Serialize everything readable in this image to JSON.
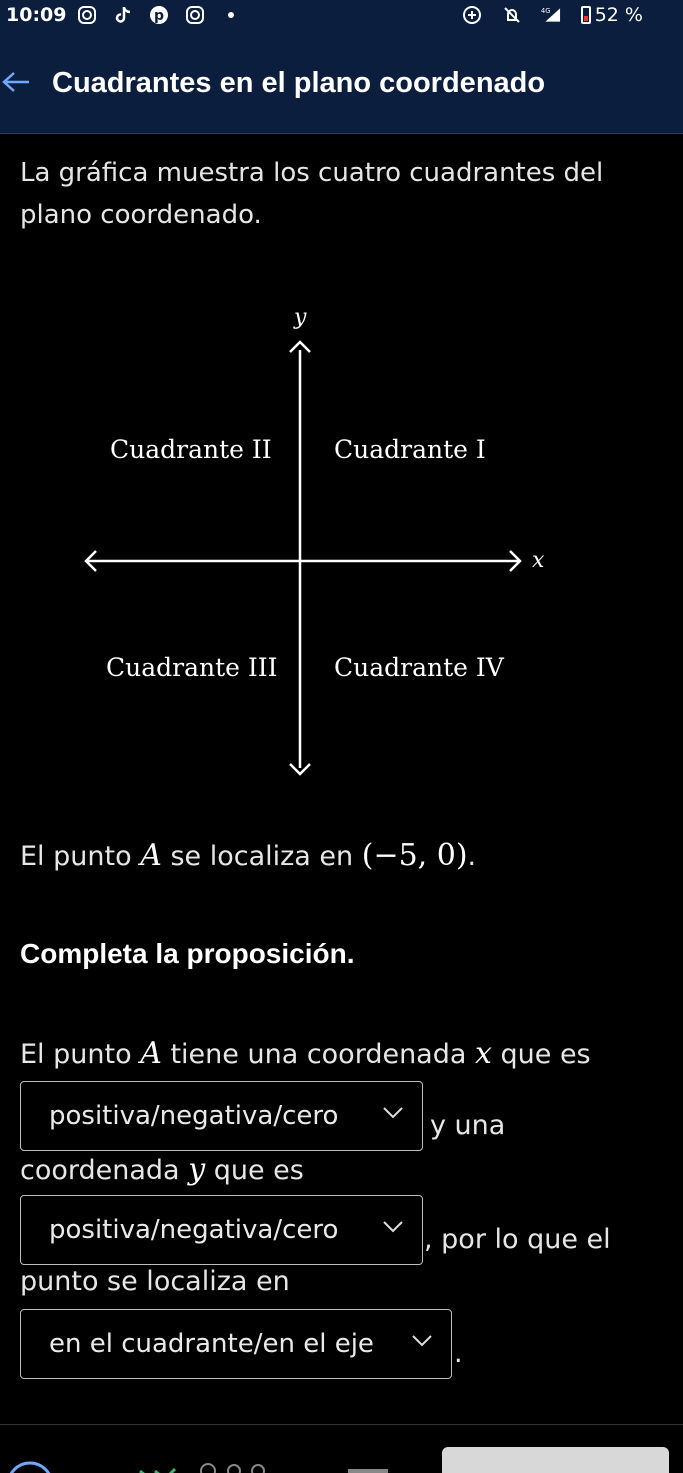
{
  "status_bar": {
    "time": "10:09",
    "battery": "52 %",
    "network": "4G"
  },
  "header": {
    "title": "Cuadrantes en el plano coordenado"
  },
  "intro_text": "La gráfica muestra los cuatro cuadrantes del plano coordenado.",
  "graph": {
    "y_axis_label": "y",
    "x_axis_label": "x",
    "quadrants": [
      "Cuadrante I",
      "Cuadrante II",
      "Cuadrante III",
      "Cuadrante IV"
    ]
  },
  "point_statement": {
    "prefix": "El punto ",
    "point_name": "A",
    "middle": " se localiza en ",
    "coordinates": "(−5, 0)",
    "suffix": "."
  },
  "instruction": "Completa la proposición.",
  "proposition": {
    "part1_prefix": "El punto ",
    "part1_point": "A",
    "part1_middle": " tiene una coordenada ",
    "part1_var": "x",
    "part1_suffix": " que es",
    "dropdown1": "positiva/negativa/cero",
    "part2": " y una",
    "part3_prefix": "coordenada ",
    "part3_var": "y",
    "part3_suffix": " que es",
    "dropdown2": "positiva/negativa/cero",
    "part4": ", por lo que el",
    "part5": "punto se localiza en",
    "dropdown3": "en el cuadrante/en el eje",
    "end": "."
  },
  "colors": {
    "header_bg": "#0b1e3d",
    "page_bg": "#000000",
    "text": "#e6e6e6"
  }
}
